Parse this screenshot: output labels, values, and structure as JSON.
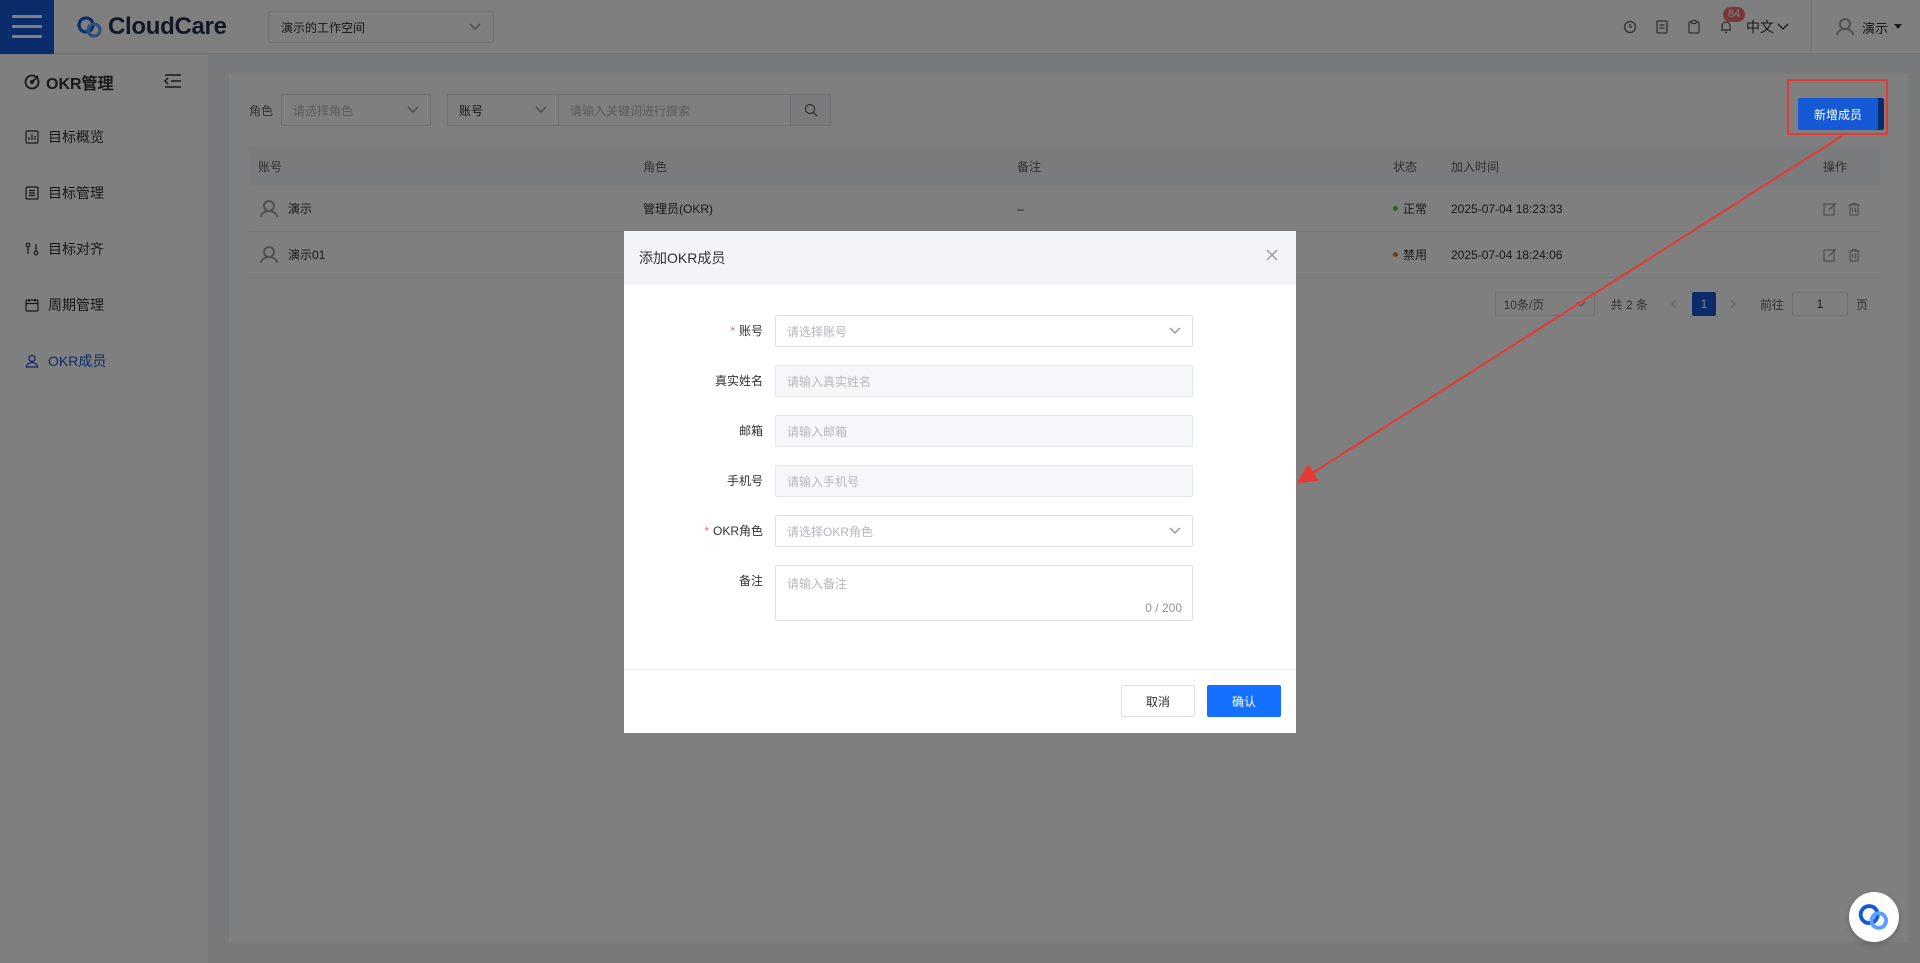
{
  "header": {
    "logo_text": "CloudCare",
    "workspace": "演示的工作空间",
    "notif_count": "84",
    "language": "中文",
    "user": "演示"
  },
  "sidebar": {
    "title": "OKR管理",
    "items": [
      {
        "label": "目标概览",
        "icon": "overview-icon"
      },
      {
        "label": "目标管理",
        "icon": "list-icon"
      },
      {
        "label": "目标对齐",
        "icon": "align-icon"
      },
      {
        "label": "周期管理",
        "icon": "calendar-icon"
      },
      {
        "label": "OKR成员",
        "icon": "user-icon",
        "active": true
      }
    ]
  },
  "filters": {
    "role_label": "角色",
    "role_placeholder": "请选择角色",
    "field_select": "账号",
    "search_placeholder": "请输入关键词进行搜索"
  },
  "add_button": "新增成员",
  "table": {
    "headers": [
      "账号",
      "角色",
      "备注",
      "状态",
      "加入时间",
      "操作"
    ],
    "rows": [
      {
        "account": "演示",
        "role": "管理员(OKR)",
        "note": "–",
        "status": "正常",
        "status_color": "#67c23a",
        "joined": "2025-07-04 18:23:33"
      },
      {
        "account": "演示01",
        "role": "",
        "note": "",
        "status": "禁用",
        "status_color": "#e6702e",
        "joined": "2025-07-04 18:24:06"
      }
    ]
  },
  "pagination": {
    "page_size": "10条/页",
    "total": "共 2 条",
    "current": "1",
    "goto_label": "前往",
    "goto_value": "1",
    "page_suffix": "页"
  },
  "dialog": {
    "title": "添加OKR成员",
    "fields": {
      "account_label": "账号",
      "account_placeholder": "请选择账号",
      "realname_label": "真实姓名",
      "realname_placeholder": "请输入真实姓名",
      "email_label": "邮箱",
      "email_placeholder": "请输入邮箱",
      "phone_label": "手机号",
      "phone_placeholder": "请输入手机号",
      "role_label": "OKR角色",
      "role_placeholder": "请选择OKR角色",
      "note_label": "备注",
      "note_placeholder": "请输入备注",
      "note_count": "0 / 200"
    },
    "cancel": "取消",
    "confirm": "确认"
  },
  "colors": {
    "primary": "#1659d6",
    "confirm": "#1670ff",
    "annotation": "#e53935"
  }
}
